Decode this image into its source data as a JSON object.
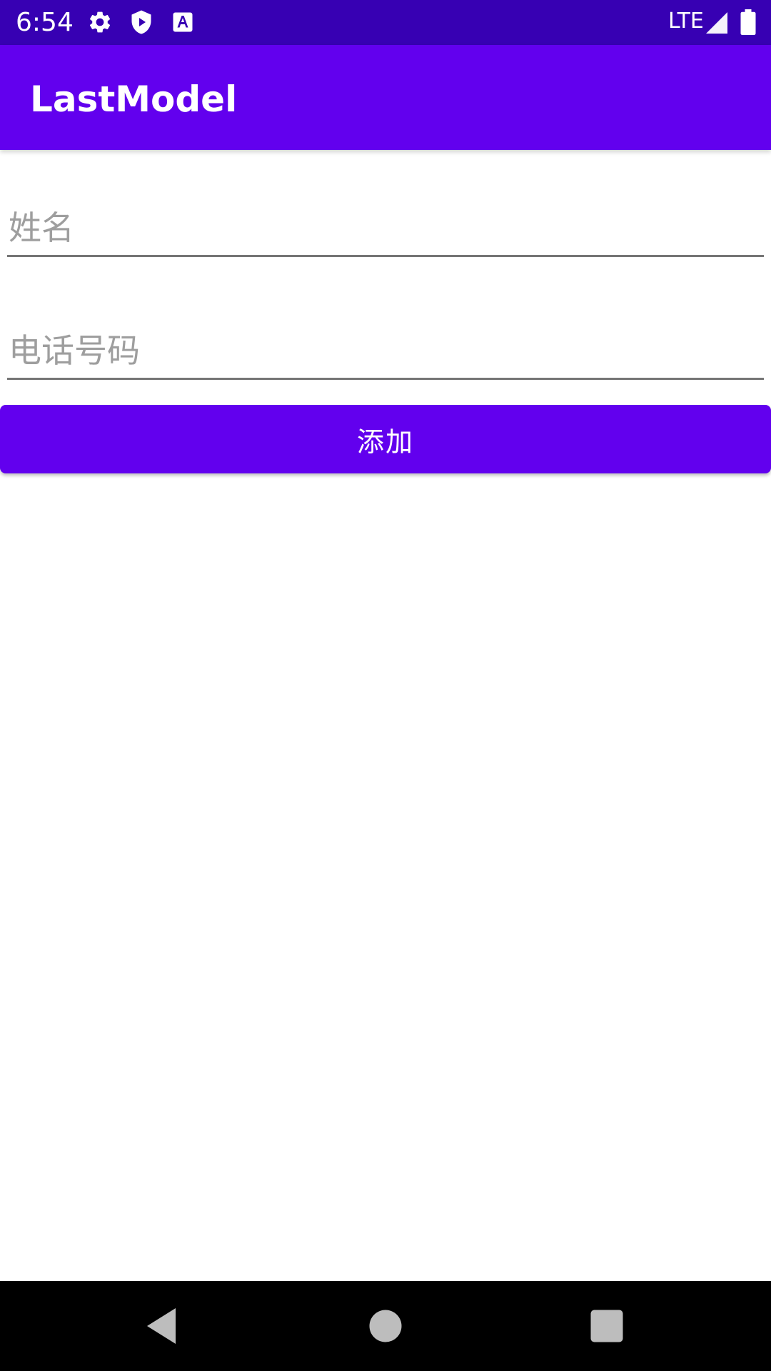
{
  "status_bar": {
    "time": "6:54",
    "network": "LTE",
    "icons": [
      "gear-icon",
      "shield-play-icon",
      "font-a-icon",
      "signal-icon",
      "battery-icon"
    ]
  },
  "app_bar": {
    "title": "LastModel"
  },
  "form": {
    "name_placeholder": "姓名",
    "phone_placeholder": "电话号码",
    "add_label": "添加"
  },
  "nav_bar": {
    "icons": [
      "back-icon",
      "home-icon",
      "recents-icon"
    ]
  },
  "colors": {
    "status_bar": "#3700b3",
    "primary": "#6200ee",
    "nav_bar": "#000000",
    "hint": "#9e9e9e",
    "underline": "#757575"
  }
}
